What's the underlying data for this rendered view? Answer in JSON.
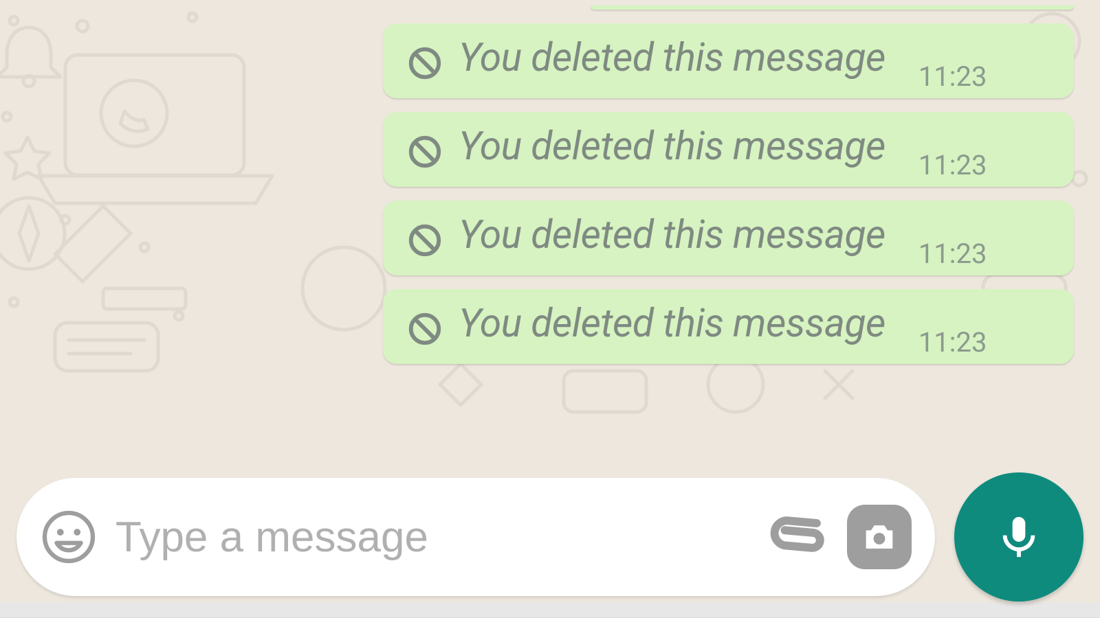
{
  "messages": [
    {
      "text": "You deleted this message",
      "time": "11:23"
    },
    {
      "text": "You deleted this message",
      "time": "11:23"
    },
    {
      "text": "You deleted this message",
      "time": "11:23"
    },
    {
      "text": "You deleted this message",
      "time": "11:23"
    }
  ],
  "composer": {
    "placeholder": "Type a message"
  },
  "colors": {
    "bubble": "#D6F3C1",
    "accent": "#0F8B7E",
    "wallpaper": "#EDE7DE"
  }
}
